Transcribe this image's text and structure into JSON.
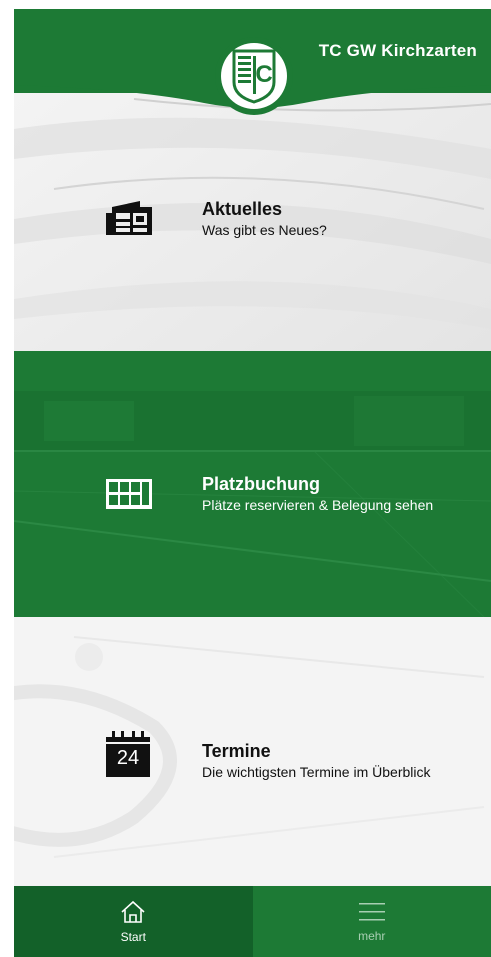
{
  "header": {
    "title": "TC GW Kirchzarten",
    "logo_letters": "TC"
  },
  "tiles": [
    {
      "id": "aktuelles",
      "title": "Aktuelles",
      "subtitle": "Was gibt es Neues?",
      "icon": "newspaper-icon"
    },
    {
      "id": "platzbuchung",
      "title": "Platzbuchung",
      "subtitle": "Plätze reservieren & Belegung sehen",
      "icon": "court-grid-icon"
    },
    {
      "id": "termine",
      "title": "Termine",
      "subtitle": "Die wichtigsten Termine im Überblick",
      "icon": "calendar-icon",
      "calendar_day": "24"
    }
  ],
  "bottom_nav": [
    {
      "label": "Start",
      "icon": "home-icon",
      "active": true
    },
    {
      "label": "mehr",
      "icon": "menu-icon",
      "active": false
    }
  ],
  "colors": {
    "brand_green": "#1d7a35",
    "dark_green": "#136129",
    "inactive_label": "#a8cfb2"
  }
}
